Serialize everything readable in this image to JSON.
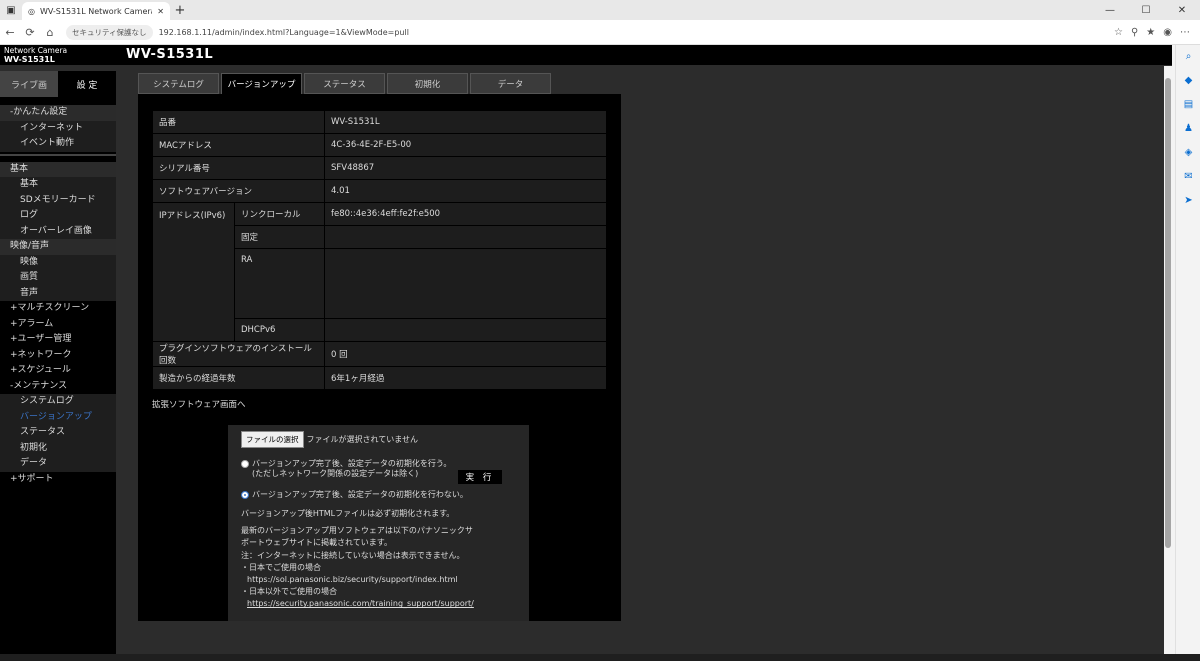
{
  "browser": {
    "tab_title": "WV-S1531L Network Camera",
    "security_label": "セキュリティ保護なし",
    "url": "192.168.1.11/admin/index.html?Language=1&ViewMode=pull"
  },
  "header": {
    "brand_line1": "Network Camera",
    "brand_line2": "WV-S1531L",
    "model": "WV-S1531L"
  },
  "mode_tabs": {
    "live": "ライブ画",
    "setup": "設 定"
  },
  "sidebar": [
    {
      "label": "-かんたん設定",
      "type": "hdr"
    },
    {
      "label": "インターネット",
      "type": "sub"
    },
    {
      "label": "イベント動作",
      "type": "sub"
    },
    {
      "label": "基本",
      "type": "hdr"
    },
    {
      "label": "基本",
      "type": "sub"
    },
    {
      "label": "SDメモリーカード",
      "type": "sub"
    },
    {
      "label": "ログ",
      "type": "sub"
    },
    {
      "label": "オーバーレイ画像",
      "type": "sub"
    },
    {
      "label": "映像/音声",
      "type": "hdr"
    },
    {
      "label": "映像",
      "type": "sub"
    },
    {
      "label": "画質",
      "type": "sub"
    },
    {
      "label": "音声",
      "type": "sub"
    },
    {
      "label": "+マルチスクリーン",
      "type": "top"
    },
    {
      "label": "+アラーム",
      "type": "top"
    },
    {
      "label": "+ユーザー管理",
      "type": "top"
    },
    {
      "label": "+ネットワーク",
      "type": "top"
    },
    {
      "label": "+スケジュール",
      "type": "top"
    },
    {
      "label": "-メンテナンス",
      "type": "top"
    },
    {
      "label": "システムログ",
      "type": "sub"
    },
    {
      "label": "バージョンアップ",
      "type": "sub",
      "active": true
    },
    {
      "label": "ステータス",
      "type": "sub"
    },
    {
      "label": "初期化",
      "type": "sub"
    },
    {
      "label": "データ",
      "type": "sub"
    },
    {
      "label": "+サポート",
      "type": "top"
    }
  ],
  "tabs": [
    "システムログ",
    "バージョンアップ",
    "ステータス",
    "初期化",
    "データ"
  ],
  "info": {
    "model_label": "品番",
    "model_value": "WV-S1531L",
    "mac_label": "MACアドレス",
    "mac_value": "4C-36-4E-2F-E5-00",
    "serial_label": "シリアル番号",
    "serial_value": "SFV48867",
    "sw_label": "ソフトウェアバージョン",
    "sw_value": "4.01",
    "ipv6_label": "IPアドレス(IPv6)",
    "linklocal_label": "リンクローカル",
    "linklocal_value": "fe80::4e36:4eff:fe2f:e500",
    "manual_label": "固定",
    "ra_label": "RA",
    "dhcpv6_label": "DHCPv6",
    "plugin_label": "プラグインソフトウェアのインストール回数",
    "plugin_value": "0 回",
    "elapsed_label": "製造からの経過年数",
    "elapsed_value": "6年1ヶ月経過"
  },
  "ext_link": "拡張ソフトウェア画面へ",
  "update": {
    "file_button": "ファイルの選択",
    "file_status": "ファイルが選択されていません",
    "option1_line1": "バージョンアップ完了後、設定データの初期化を行う。",
    "option1_line2": "(ただしネットワーク関係の設定データは除く)",
    "option2": "バージョンアップ完了後、設定データの初期化を行わない。",
    "run_button": "実 行",
    "note_lines": [
      "バージョンアップ後HTMLファイルは必ず初期化されます。",
      "最新のバージョンアップ用ソフトウェアは以下のパナソニックサ",
      "ポートウェブサイトに掲載されています。",
      "注：インターネットに接続していない場合は表示できません。",
      "・日本でご使用の場合",
      "https://sol.panasonic.biz/security/support/index.html",
      "・日本以外でご使用の場合",
      "https://security.panasonic.com/training_support/support/"
    ]
  }
}
